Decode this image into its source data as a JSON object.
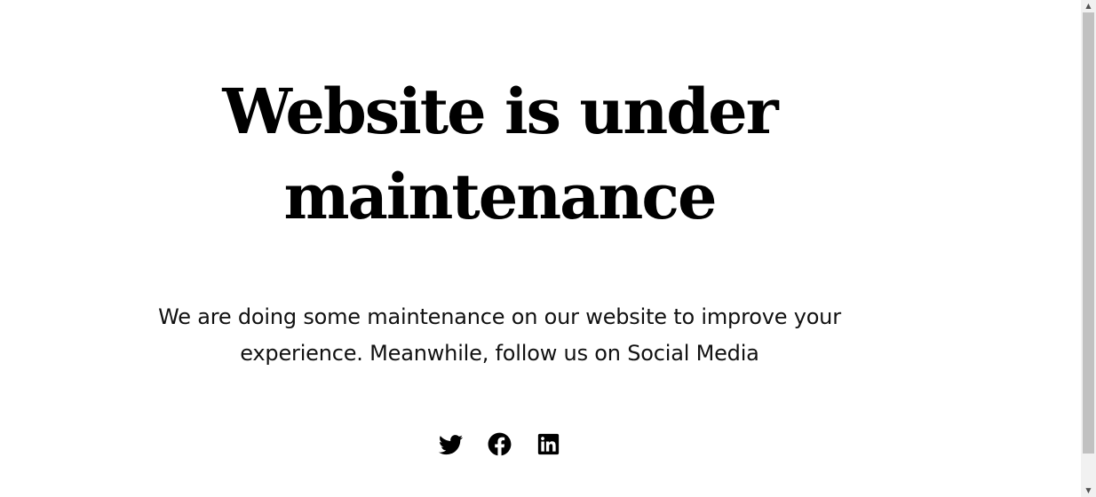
{
  "headline": {
    "line1": "Website is under",
    "line2": "maintenance"
  },
  "message": "We are doing some maintenance on our website to improve your experience. Meanwhile, follow us on Social Media",
  "social": {
    "twitter": "twitter-icon",
    "facebook": "facebook-icon",
    "linkedin": "linkedin-icon"
  },
  "scrollbar": {
    "up_arrow": "▲",
    "down_arrow": "▼"
  }
}
